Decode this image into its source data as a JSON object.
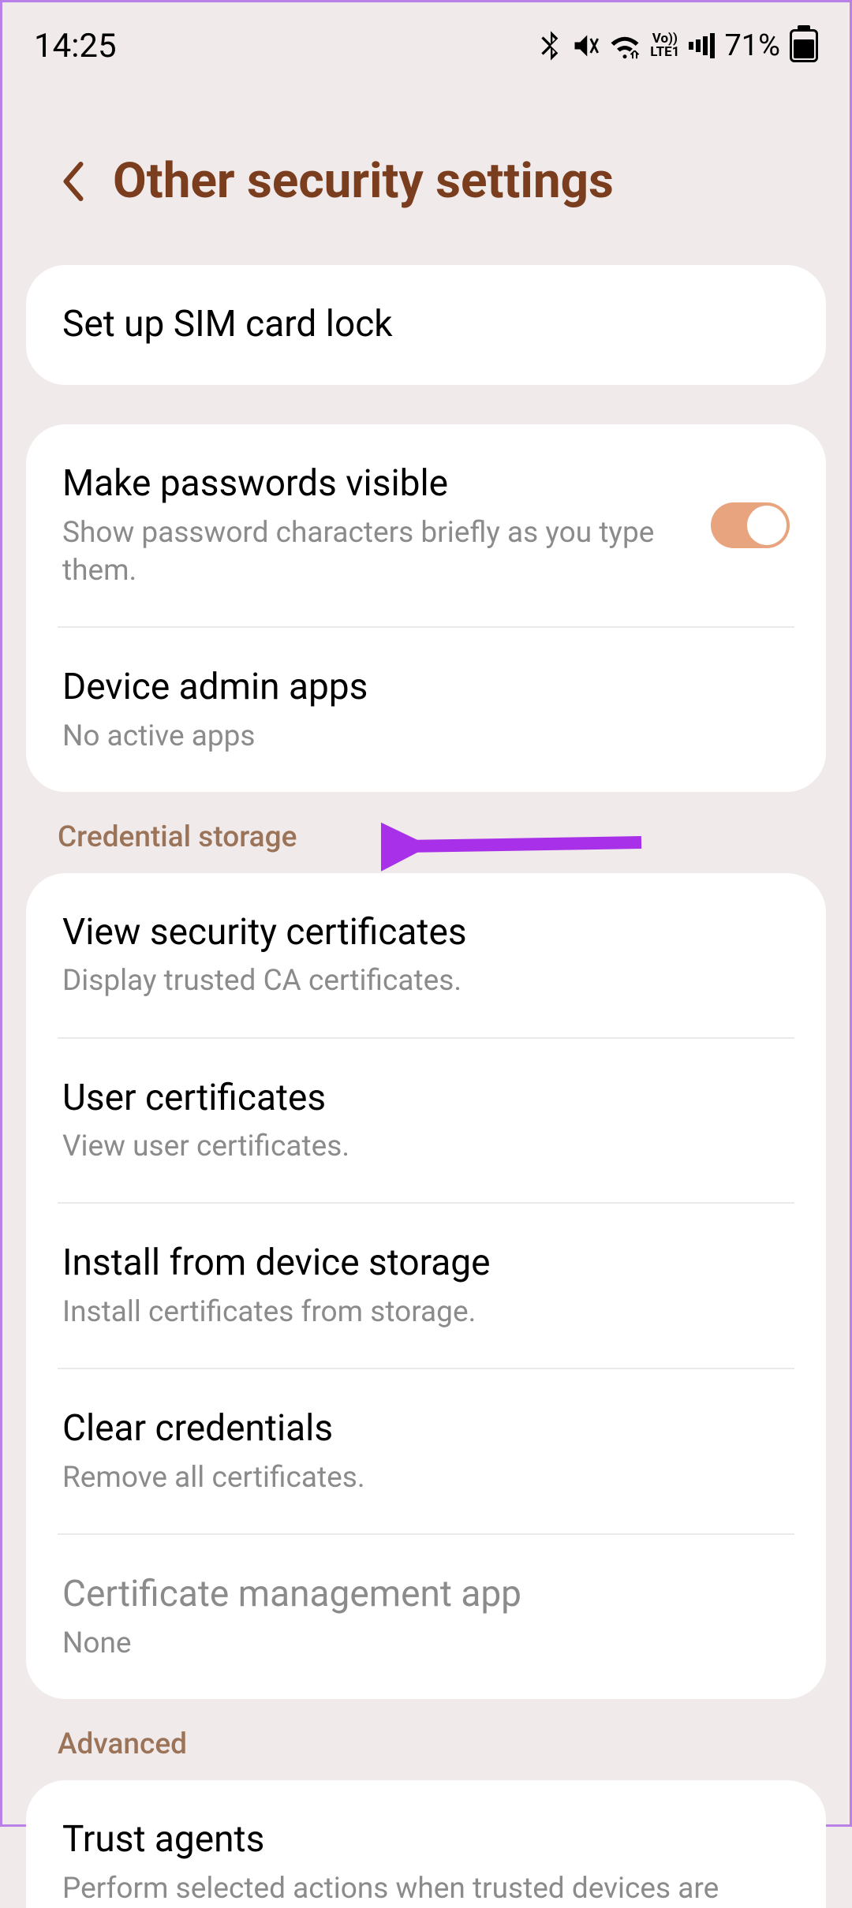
{
  "status": {
    "time": "14:25",
    "battery": "71%",
    "volte": "Vo))\nLTE1"
  },
  "header": {
    "title": "Other security settings"
  },
  "sections": [
    {
      "items": [
        {
          "title": "Set up SIM card lock"
        }
      ]
    },
    {
      "items": [
        {
          "title": "Make passwords visible",
          "subtitle": "Show password characters briefly as you type them.",
          "toggle": true
        },
        {
          "title": "Device admin apps",
          "subtitle": "No active apps"
        }
      ]
    }
  ],
  "sectionLabels": {
    "credential": "Credential storage",
    "advanced": "Advanced"
  },
  "credentialSection": {
    "items": [
      {
        "title": "View security certificates",
        "subtitle": "Display trusted CA certificates."
      },
      {
        "title": "User certificates",
        "subtitle": "View user certificates."
      },
      {
        "title": "Install from device storage",
        "subtitle": "Install certificates from storage."
      },
      {
        "title": "Clear credentials",
        "subtitle": "Remove all certificates."
      },
      {
        "title": "Certificate management app",
        "subtitle": "None",
        "disabled": true
      }
    ]
  },
  "advancedSection": {
    "items": [
      {
        "title": "Trust agents",
        "subtitle": "Perform selected actions when trusted devices are"
      }
    ]
  }
}
